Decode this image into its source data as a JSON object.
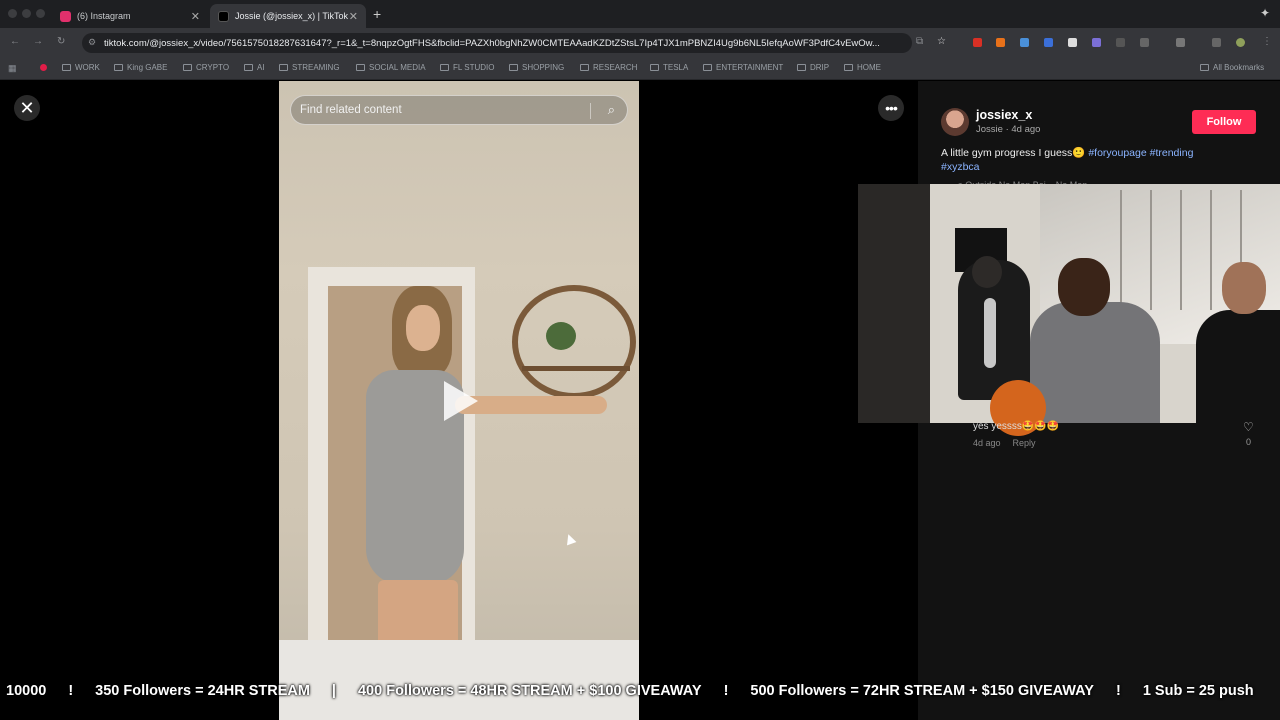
{
  "browser": {
    "tabs": [
      {
        "title": "(6) Instagram",
        "active": false,
        "favicon_color": "#e1306c"
      },
      {
        "title": "Jossie (@jossiex_x) | TikTok",
        "active": true,
        "favicon_color": "#000000"
      }
    ],
    "new_tab_symbol": "+",
    "url": "tiktok.com/@jossiex_x/video/7561575018287631647?_r=1&_t=8nqpzOgtFHS&fbclid=PAZXh0bgNhZW0CMTEAAadKZDtZStsL7Ip4TJX1mPBNZI4Ug9b6NL5IefqAoWF3PdfC4vEwOw...",
    "bookmarks": [
      "WORK",
      "King GABE",
      "CRYPTO",
      "AI",
      "STREAMING",
      "SOCIAL MEDIA",
      "FL STUDIO",
      "SHOPPING",
      "RESEARCH",
      "TESLA",
      "ENTERTAINMENT",
      "DRIP",
      "HOME"
    ],
    "all_bookmarks": "All Bookmarks"
  },
  "player": {
    "search_placeholder": "Find related content"
  },
  "post": {
    "username": "jossiex_x",
    "subline": "Jossie · 4d ago",
    "follow_label": "Follow",
    "caption_text": "A little gym progress I guess",
    "caption_emoji": "🙂",
    "hashtags": [
      "#foryoupage",
      "#trending",
      "#xyzbca"
    ],
    "music": "♫ Outside No Man Bei... No Man..."
  },
  "comment": {
    "text": "yes yessss🤩🤩🤩",
    "time": "4d ago",
    "reply": "Reply",
    "likes": "0"
  },
  "ticker": {
    "items": [
      "10000",
      "350 Followers = 24HR STREAM",
      "400 Followers = 48HR STREAM + $100 GIVEAWAY",
      "500 Followers = 72HR STREAM + $150 GIVEAWAY",
      "1 Sub = 25 push"
    ]
  },
  "colors": {
    "accent": "#fe2c55",
    "hashtag": "#8bb4ff",
    "panel_bg": "#121212"
  }
}
